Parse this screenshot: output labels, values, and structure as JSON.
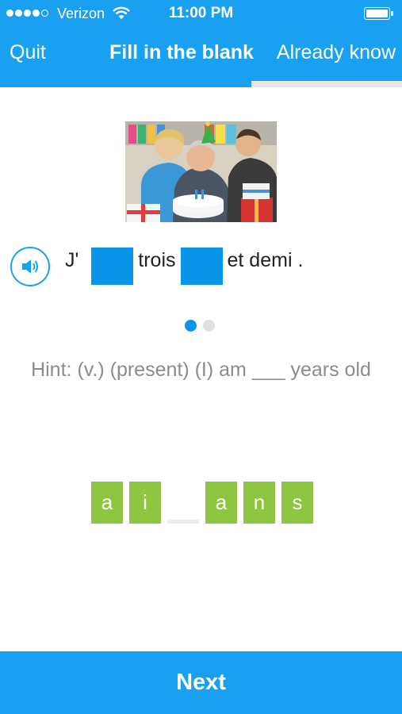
{
  "status_bar": {
    "carrier": "Verizon",
    "time": "11:00 PM",
    "signal_bars_filled": 4,
    "signal_bars_total": 5,
    "battery_level": 1.0
  },
  "nav": {
    "left_label": "Quit",
    "title": "Fill in the blank",
    "right_label": "Already know"
  },
  "progress": 0.625,
  "exercise": {
    "sentence": {
      "word_1": "J'",
      "word_2": "trois",
      "word_3": "et demi ."
    },
    "hint": "Hint:  (v.) (present) (I) am ___ years old",
    "pager": {
      "total": 2,
      "active_index": 0
    },
    "letter_tiles": [
      "a",
      "i",
      "",
      "a",
      "n",
      "s"
    ]
  },
  "footer": {
    "next_label": "Next"
  },
  "colors": {
    "accent": "#1aa0f0",
    "blank": "#0a96e8",
    "tile": "#8dc63f",
    "hint_text": "#8c8c8c"
  },
  "icons": {
    "audio": "speaker-icon",
    "wifi": "wifi-icon",
    "battery": "battery-icon"
  }
}
